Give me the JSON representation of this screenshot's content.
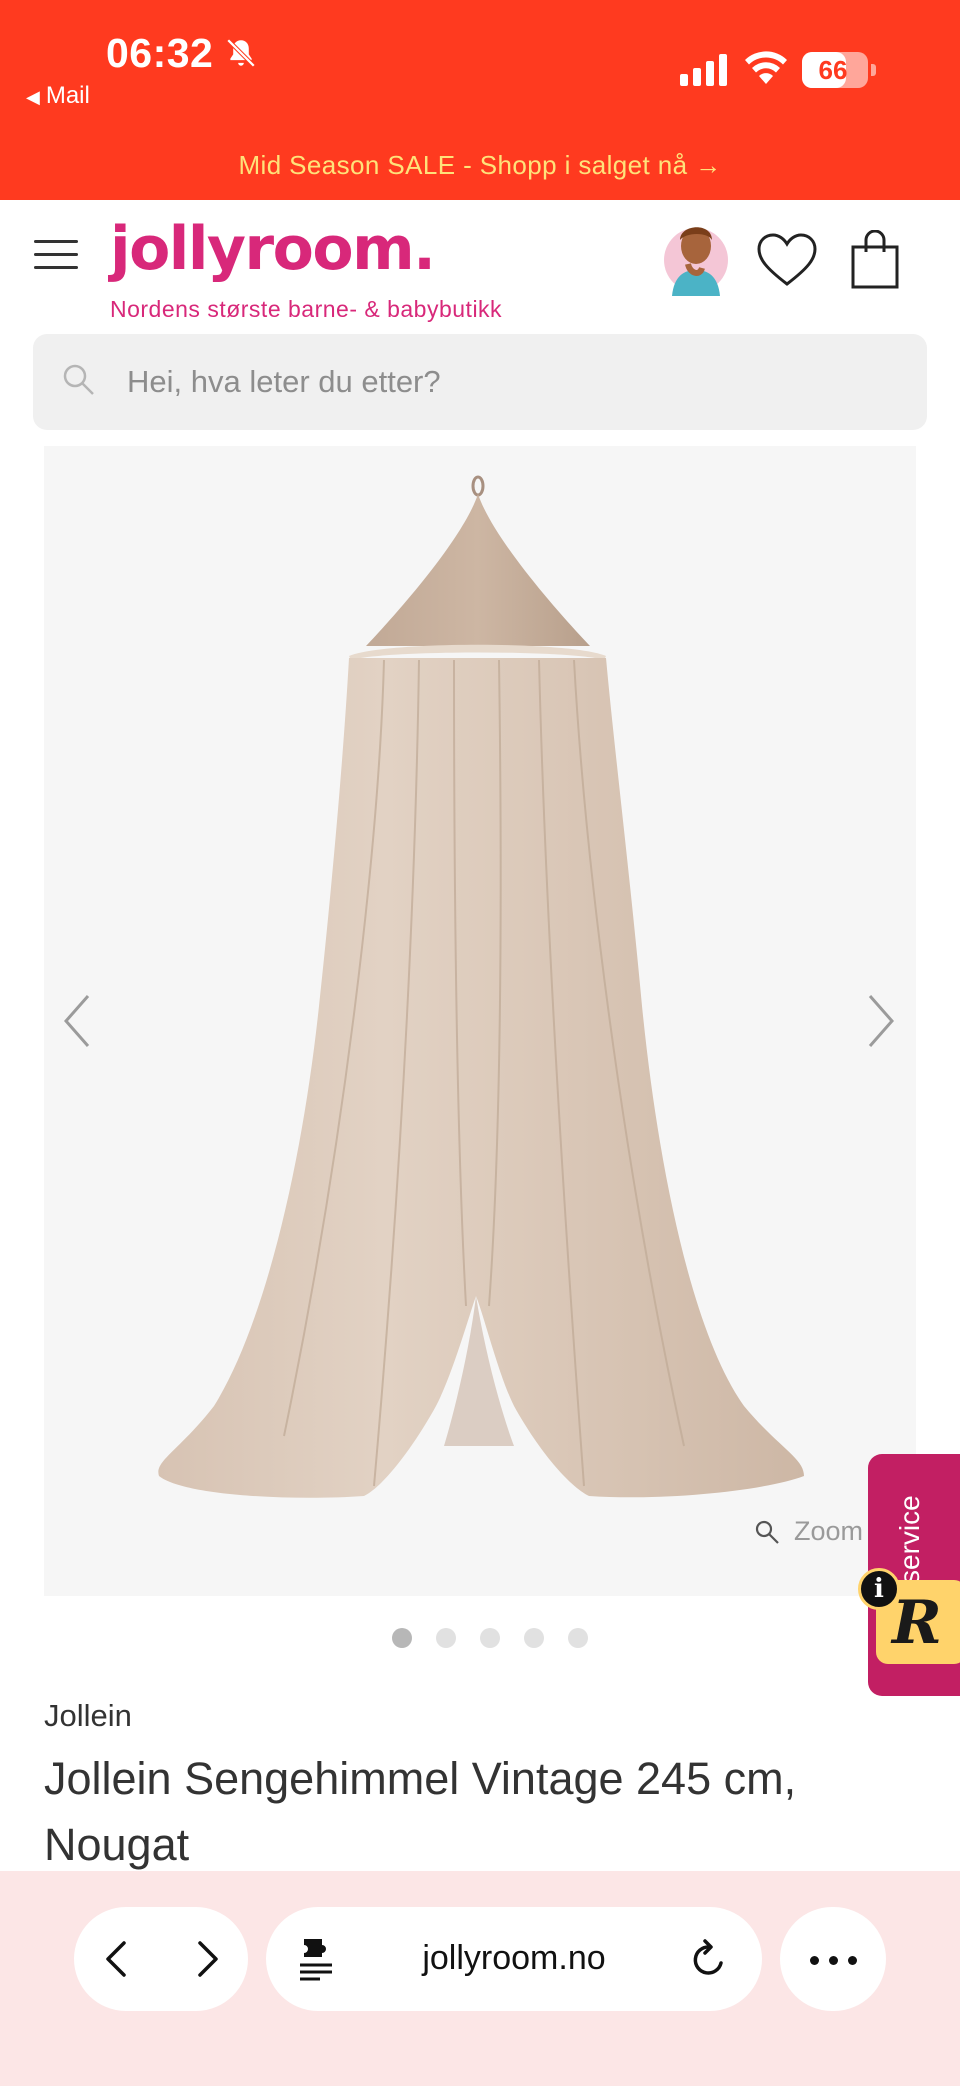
{
  "status_bar": {
    "time": "06:32",
    "back_app": "Mail",
    "battery_percent": 66
  },
  "promo": {
    "text": "Mid Season SALE - Shopp i salget nå →"
  },
  "header": {
    "logo": "jollyroom.",
    "tagline": "Nordens største barne- & babybutikk",
    "icons": [
      "menu-icon",
      "avatar",
      "heart-icon",
      "shopping-bag-icon"
    ]
  },
  "search": {
    "placeholder": "Hei, hva leter du etter?"
  },
  "gallery": {
    "zoom_label": "Zoom",
    "image_count": 5,
    "active_index": 0
  },
  "service_tab": {
    "label": "service",
    "badge_letter": "R",
    "info_letter": "i"
  },
  "product": {
    "brand": "Jollein",
    "title": "Jollein Sengehimmel Vintage 245 cm, Nougat"
  },
  "browser": {
    "url": "jollyroom.no"
  },
  "colors": {
    "topband": "#ff3a1f",
    "promo_text": "#ffe27a",
    "brand_pink": "#d8287a",
    "service_bg": "#c21f63",
    "service_badge": "#ffd36b",
    "browser_bar": "#fce6e6"
  }
}
